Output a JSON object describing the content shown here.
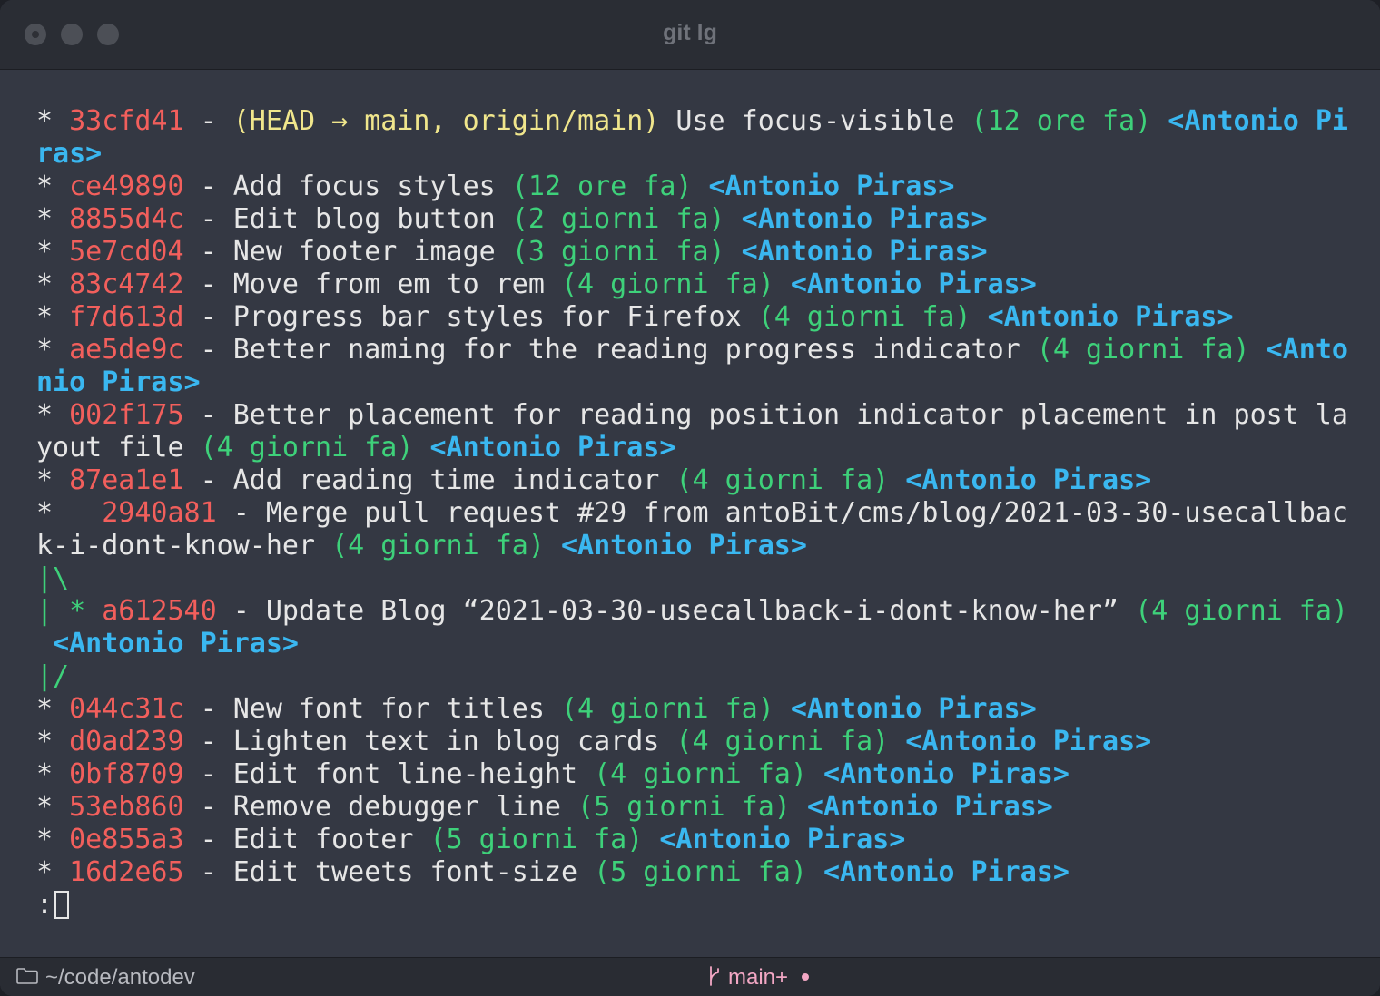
{
  "window": {
    "title": "git lg"
  },
  "log": [
    {
      "kind": "commit",
      "graph": "* ",
      "hash": "33cfd41",
      "refs": "(HEAD → main, origin/main)",
      "message": "Use focus-visible",
      "date": "(12 ore fa)",
      "author": "<Antonio Piras>"
    },
    {
      "kind": "commit",
      "graph": "* ",
      "hash": "ce49890",
      "refs": "",
      "message": "Add focus styles",
      "date": "(12 ore fa)",
      "author": "<Antonio Piras>"
    },
    {
      "kind": "commit",
      "graph": "* ",
      "hash": "8855d4c",
      "refs": "",
      "message": "Edit blog button",
      "date": "(2 giorni fa)",
      "author": "<Antonio Piras>"
    },
    {
      "kind": "commit",
      "graph": "* ",
      "hash": "5e7cd04",
      "refs": "",
      "message": "New footer image",
      "date": "(3 giorni fa)",
      "author": "<Antonio Piras>"
    },
    {
      "kind": "commit",
      "graph": "* ",
      "hash": "83c4742",
      "refs": "",
      "message": "Move from em to rem",
      "date": "(4 giorni fa)",
      "author": "<Antonio Piras>"
    },
    {
      "kind": "commit",
      "graph": "* ",
      "hash": "f7d613d",
      "refs": "",
      "message": "Progress bar styles for Firefox",
      "date": "(4 giorni fa)",
      "author": "<Antonio Piras>"
    },
    {
      "kind": "commit",
      "graph": "* ",
      "hash": "ae5de9c",
      "refs": "",
      "message": "Better naming for the reading progress indicator",
      "date": "(4 giorni fa)",
      "author": "<Antonio Piras>"
    },
    {
      "kind": "commit",
      "graph": "* ",
      "hash": "002f175",
      "refs": "",
      "message": "Better placement for reading position indicator placement in post layout file",
      "date": "(4 giorni fa)",
      "author": "<Antonio Piras>"
    },
    {
      "kind": "commit",
      "graph": "* ",
      "hash": "87ea1e1",
      "refs": "",
      "message": "Add reading time indicator",
      "date": "(4 giorni fa)",
      "author": "<Antonio Piras>"
    },
    {
      "kind": "commit",
      "graph": "*   ",
      "hash": "2940a81",
      "refs": "",
      "message": "Merge pull request #29 from antoBit/cms/blog/2021-03-30-usecallback-i-dont-know-her",
      "date": "(4 giorni fa)",
      "author": "<Antonio Piras>"
    },
    {
      "kind": "graph",
      "graph": "|\\"
    },
    {
      "kind": "commit",
      "graph": "| * ",
      "hash": "a612540",
      "refs": "",
      "message": "Update Blog “2021-03-30-usecallback-i-dont-know-her”",
      "date": "(4 giorni fa)",
      "author": "<Antonio Piras>"
    },
    {
      "kind": "graph",
      "graph": "|/"
    },
    {
      "kind": "commit",
      "graph": "* ",
      "hash": "044c31c",
      "refs": "",
      "message": "New font for titles",
      "date": "(4 giorni fa)",
      "author": "<Antonio Piras>"
    },
    {
      "kind": "commit",
      "graph": "* ",
      "hash": "d0ad239",
      "refs": "",
      "message": "Lighten text in blog cards",
      "date": "(4 giorni fa)",
      "author": "<Antonio Piras>"
    },
    {
      "kind": "commit",
      "graph": "* ",
      "hash": "0bf8709",
      "refs": "",
      "message": "Edit font line-height",
      "date": "(4 giorni fa)",
      "author": "<Antonio Piras>"
    },
    {
      "kind": "commit",
      "graph": "* ",
      "hash": "53eb860",
      "refs": "",
      "message": "Remove debugger line",
      "date": "(5 giorni fa)",
      "author": "<Antonio Piras>"
    },
    {
      "kind": "commit",
      "graph": "* ",
      "hash": "0e855a3",
      "refs": "",
      "message": "Edit footer",
      "date": "(5 giorni fa)",
      "author": "<Antonio Piras>"
    },
    {
      "kind": "commit",
      "graph": "* ",
      "hash": "16d2e65",
      "refs": "",
      "message": "Edit tweets font-size",
      "date": "(5 giorni fa)",
      "author": "<Antonio Piras>"
    }
  ],
  "pager": {
    "prompt": ":"
  },
  "statusbar": {
    "path": "~/code/antodev",
    "branch": "main+",
    "folder_icon": "folder-icon",
    "branch_icon": "git-branch-icon"
  },
  "colors": {
    "background": "#343843",
    "hash": "#f25f5c",
    "refs": "#f0e68c",
    "date": "#3ed17a",
    "author": "#3ab7f0",
    "branch": "#f2a7c4"
  }
}
